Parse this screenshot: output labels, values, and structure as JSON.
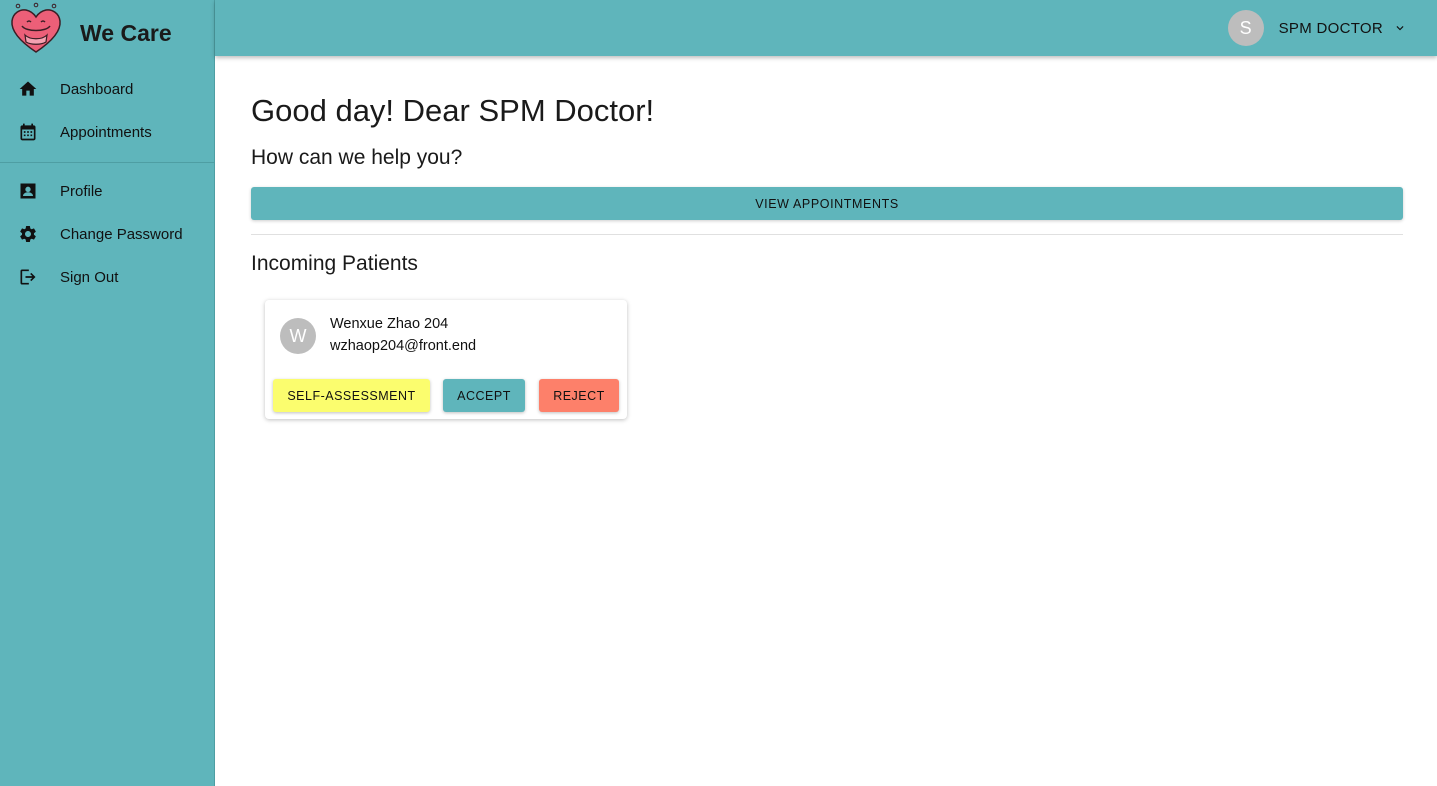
{
  "app": {
    "name": "We Care"
  },
  "sidebar": {
    "items": [
      {
        "label": "Dashboard",
        "icon": "home-icon"
      },
      {
        "label": "Appointments",
        "icon": "calendar-icon"
      },
      {
        "label": "Profile",
        "icon": "contact-card-icon"
      },
      {
        "label": "Change Password",
        "icon": "gear-icon"
      },
      {
        "label": "Sign Out",
        "icon": "logout-icon"
      }
    ]
  },
  "header": {
    "user_initial": "S",
    "user_name": "SPM DOCTOR"
  },
  "main": {
    "greeting": "Good day! Dear SPM Doctor!",
    "help_prompt": "How can we help you?",
    "view_appointments_label": "VIEW APPOINTMENTS",
    "incoming_title": "Incoming Patients",
    "patients": [
      {
        "initial": "W",
        "name": "Wenxue Zhao 204",
        "email": "wzhaop204@front.end",
        "self_assessment_label": "SELF-ASSESSMENT",
        "accept_label": "ACCEPT",
        "reject_label": "REJECT"
      }
    ]
  },
  "colors": {
    "primary": "#5fb5bb",
    "assessment": "#fbfd6e",
    "reject": "#fd806a",
    "avatar": "#bdbdbd"
  }
}
